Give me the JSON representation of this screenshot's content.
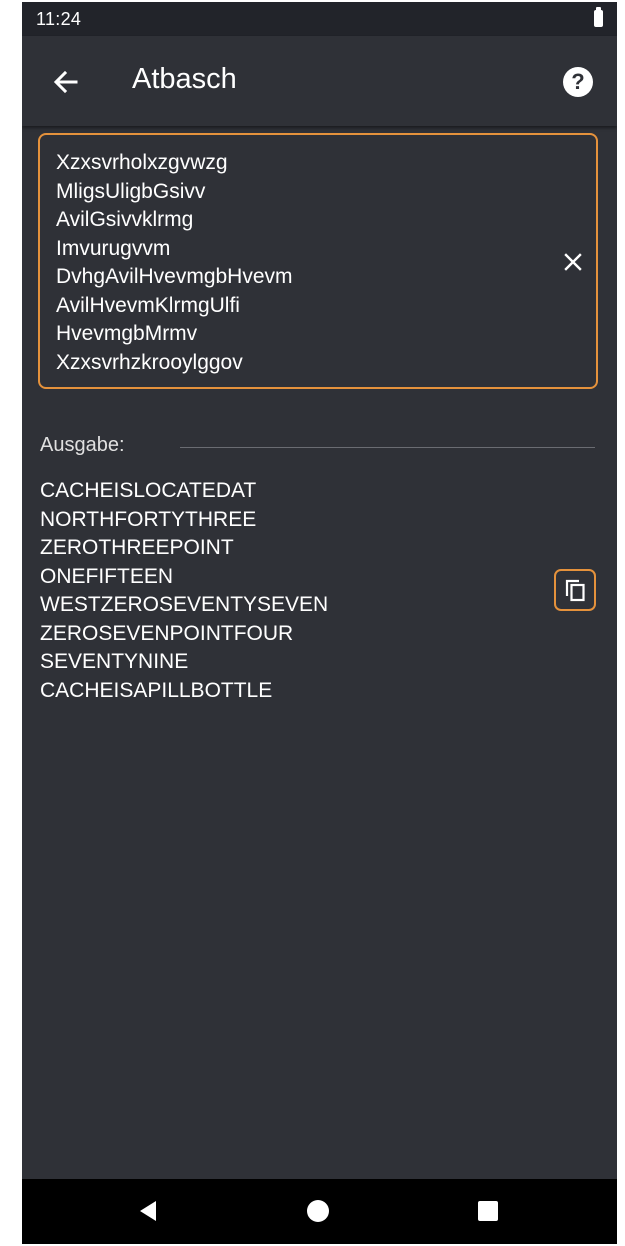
{
  "status_bar": {
    "time": "11:24"
  },
  "app_bar": {
    "title": "Atbasch",
    "back_icon": "arrow-back-icon",
    "help_icon": "help-circle-icon",
    "help_glyph": "?"
  },
  "input": {
    "lines": [
      "Xzxsvrholxzgvwzg",
      "MligsUligbGsivv",
      "AvilGsivvklrmg",
      "Imvurugvvm",
      "DvhgAvilHvevmgbHvevm",
      "AvilHvevmKlrmgUlfi",
      "HvevmgbMrmv",
      "Xzxsvrhzkrooylggov"
    ],
    "clear_icon": "close-icon",
    "accent_color": "#e5923c"
  },
  "output": {
    "label": "Ausgabe:",
    "lines": [
      "CACHEISLOCATEDAT",
      "NORTHFORTYTHREE",
      "ZEROTHREEPOINT",
      "ONEFIFTEEN",
      "WESTZEROSEVENTYSEVEN",
      "ZEROSEVENPOINTFOUR",
      "SEVENTYNINE",
      "CACHEISAPILLBOTTLE"
    ],
    "copy_icon": "copy-icon"
  },
  "nav_bar": {
    "back_icon": "triangle-back-icon",
    "home_icon": "circle-home-icon",
    "recents_icon": "square-recents-icon"
  },
  "colors": {
    "background": "#2f3137",
    "status_bar": "#22242a",
    "accent": "#e5923c",
    "text": "#ffffff",
    "nav_bar": "#000000"
  }
}
